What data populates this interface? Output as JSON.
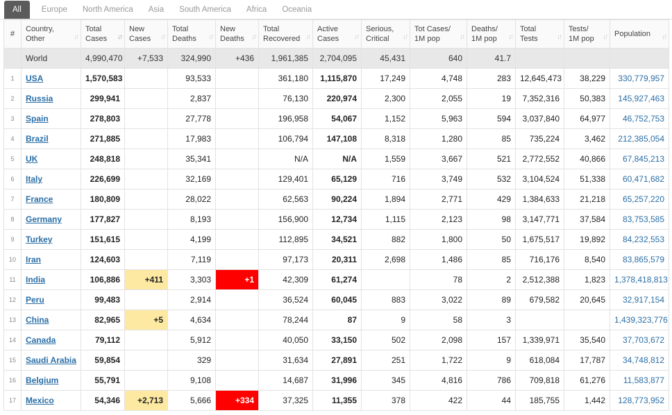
{
  "tabs": [
    "All",
    "Europe",
    "North America",
    "Asia",
    "South America",
    "Africa",
    "Oceania"
  ],
  "active_tab": "All",
  "headers": [
    {
      "text": "#",
      "sort": false
    },
    {
      "text": "Country,\nOther",
      "sort": true
    },
    {
      "text": "Total\nCases",
      "sort": true,
      "sorted": true
    },
    {
      "text": "New\nCases",
      "sort": true
    },
    {
      "text": "Total\nDeaths",
      "sort": true
    },
    {
      "text": "New\nDeaths",
      "sort": true
    },
    {
      "text": "Total\nRecovered",
      "sort": true
    },
    {
      "text": "Active\nCases",
      "sort": true
    },
    {
      "text": "Serious,\nCritical",
      "sort": true
    },
    {
      "text": "Tot Cases/\n1M pop",
      "sort": true
    },
    {
      "text": "Deaths/\n1M pop",
      "sort": true
    },
    {
      "text": "Total\nTests",
      "sort": true
    },
    {
      "text": "Tests/\n1M pop",
      "sort": true
    },
    {
      "text": "Population",
      "sort": true
    }
  ],
  "world": [
    "",
    "World",
    "4,990,470",
    "+7,533",
    "324,990",
    "+436",
    "1,961,385",
    "2,704,095",
    "45,431",
    "640",
    "41.7",
    "",
    "",
    ""
  ],
  "rows": [
    [
      "1",
      "USA",
      "1,570,583",
      "",
      "93,533",
      "",
      "361,180",
      "1,115,870",
      "17,249",
      "4,748",
      "283",
      "12,645,473",
      "38,229",
      "330,779,957"
    ],
    [
      "2",
      "Russia",
      "299,941",
      "",
      "2,837",
      "",
      "76,130",
      "220,974",
      "2,300",
      "2,055",
      "19",
      "7,352,316",
      "50,383",
      "145,927,463"
    ],
    [
      "3",
      "Spain",
      "278,803",
      "",
      "27,778",
      "",
      "196,958",
      "54,067",
      "1,152",
      "5,963",
      "594",
      "3,037,840",
      "64,977",
      "46,752,753"
    ],
    [
      "4",
      "Brazil",
      "271,885",
      "",
      "17,983",
      "",
      "106,794",
      "147,108",
      "8,318",
      "1,280",
      "85",
      "735,224",
      "3,462",
      "212,385,054"
    ],
    [
      "5",
      "UK",
      "248,818",
      "",
      "35,341",
      "",
      "N/A",
      "N/A",
      "1,559",
      "3,667",
      "521",
      "2,772,552",
      "40,866",
      "67,845,213"
    ],
    [
      "6",
      "Italy",
      "226,699",
      "",
      "32,169",
      "",
      "129,401",
      "65,129",
      "716",
      "3,749",
      "532",
      "3,104,524",
      "51,338",
      "60,471,682"
    ],
    [
      "7",
      "France",
      "180,809",
      "",
      "28,022",
      "",
      "62,563",
      "90,224",
      "1,894",
      "2,771",
      "429",
      "1,384,633",
      "21,218",
      "65,257,220"
    ],
    [
      "8",
      "Germany",
      "177,827",
      "",
      "8,193",
      "",
      "156,900",
      "12,734",
      "1,115",
      "2,123",
      "98",
      "3,147,771",
      "37,584",
      "83,753,585"
    ],
    [
      "9",
      "Turkey",
      "151,615",
      "",
      "4,199",
      "",
      "112,895",
      "34,521",
      "882",
      "1,800",
      "50",
      "1,675,517",
      "19,892",
      "84,232,553"
    ],
    [
      "10",
      "Iran",
      "124,603",
      "",
      "7,119",
      "",
      "97,173",
      "20,311",
      "2,698",
      "1,486",
      "85",
      "716,176",
      "8,540",
      "83,865,579"
    ],
    [
      "11",
      "India",
      "106,886",
      "+411",
      "3,303",
      "+1",
      "42,309",
      "61,274",
      "",
      "78",
      "2",
      "2,512,388",
      "1,823",
      "1,378,418,813"
    ],
    [
      "12",
      "Peru",
      "99,483",
      "",
      "2,914",
      "",
      "36,524",
      "60,045",
      "883",
      "3,022",
      "89",
      "679,582",
      "20,645",
      "32,917,154"
    ],
    [
      "13",
      "China",
      "82,965",
      "+5",
      "4,634",
      "",
      "78,244",
      "87",
      "9",
      "58",
      "3",
      "",
      "",
      "1,439,323,776"
    ],
    [
      "14",
      "Canada",
      "79,112",
      "",
      "5,912",
      "",
      "40,050",
      "33,150",
      "502",
      "2,098",
      "157",
      "1,339,971",
      "35,540",
      "37,703,672"
    ],
    [
      "15",
      "Saudi Arabia",
      "59,854",
      "",
      "329",
      "",
      "31,634",
      "27,891",
      "251",
      "1,722",
      "9",
      "618,084",
      "17,787",
      "34,748,812"
    ],
    [
      "16",
      "Belgium",
      "55,791",
      "",
      "9,108",
      "",
      "14,687",
      "31,996",
      "345",
      "4,816",
      "786",
      "709,818",
      "61,276",
      "11,583,877"
    ],
    [
      "17",
      "Mexico",
      "54,346",
      "+2,713",
      "5,666",
      "+334",
      "37,325",
      "11,355",
      "378",
      "422",
      "44",
      "185,755",
      "1,442",
      "128,773,952"
    ]
  ],
  "colors": {
    "new_cases_bg": "#fde9a1",
    "new_deaths_bg": "#ff0000",
    "link": "#2a6ea6",
    "world_bg": "#e8e8e8"
  }
}
